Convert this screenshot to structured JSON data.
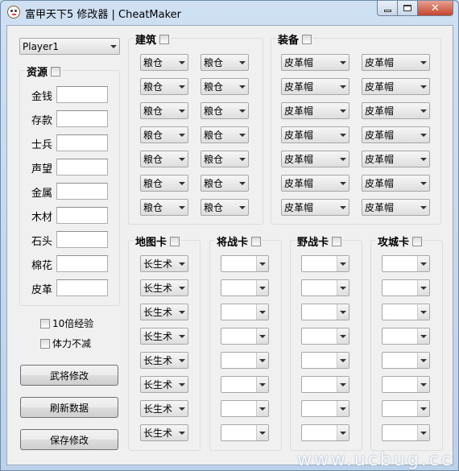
{
  "window": {
    "title": "富甲天下5 修改器 | CheatMaker",
    "icon": "app-panda-icon",
    "controls": {
      "minimize": "minimize-icon",
      "maximize": "maximize-icon",
      "close": "✕"
    }
  },
  "player_select": {
    "value": "Player1"
  },
  "resources": {
    "title": "资源",
    "fields": [
      {
        "label": "金钱",
        "value": ""
      },
      {
        "label": "存款",
        "value": ""
      },
      {
        "label": "士兵",
        "value": ""
      },
      {
        "label": "声望",
        "value": ""
      },
      {
        "label": "金属",
        "value": ""
      },
      {
        "label": "木材",
        "value": ""
      },
      {
        "label": "石头",
        "value": ""
      },
      {
        "label": "棉花",
        "value": ""
      },
      {
        "label": "皮革",
        "value": ""
      }
    ]
  },
  "options": {
    "exp10x": "10倍经验",
    "stamina": "体力不减"
  },
  "buttons": {
    "general": "武将修改",
    "refresh": "刷新数据",
    "save": "保存修改"
  },
  "buildings": {
    "title": "建筑",
    "col1": [
      "粮仓",
      "粮仓",
      "粮仓",
      "粮仓",
      "粮仓",
      "粮仓",
      "粮仓"
    ],
    "col2": [
      "粮仓",
      "粮仓",
      "粮仓",
      "粮仓",
      "粮仓",
      "粮仓",
      "粮仓"
    ]
  },
  "equipment": {
    "title": "装备",
    "col1": [
      "皮革帽",
      "皮革帽",
      "皮革帽",
      "皮革帽",
      "皮革帽",
      "皮革帽",
      "皮革帽"
    ],
    "col2": [
      "皮革帽",
      "皮革帽",
      "皮革帽",
      "皮革帽",
      "皮革帽",
      "皮革帽",
      "皮革帽"
    ]
  },
  "map_cards": {
    "title": "地图卡",
    "items": [
      "长生术",
      "长生术",
      "长生术",
      "长生术",
      "长生术",
      "长生术",
      "长生术",
      "长生术"
    ]
  },
  "general_cards": {
    "title": "将战卡",
    "items": [
      "",
      "",
      "",
      "",
      "",
      "",
      "",
      ""
    ]
  },
  "field_cards": {
    "title": "野战卡",
    "items": [
      "",
      "",
      "",
      "",
      "",
      "",
      "",
      ""
    ]
  },
  "siege_cards": {
    "title": "攻城卡",
    "items": [
      "",
      "",
      "",
      "",
      "",
      "",
      "",
      ""
    ]
  },
  "watermark": "www.ucbug.cc"
}
